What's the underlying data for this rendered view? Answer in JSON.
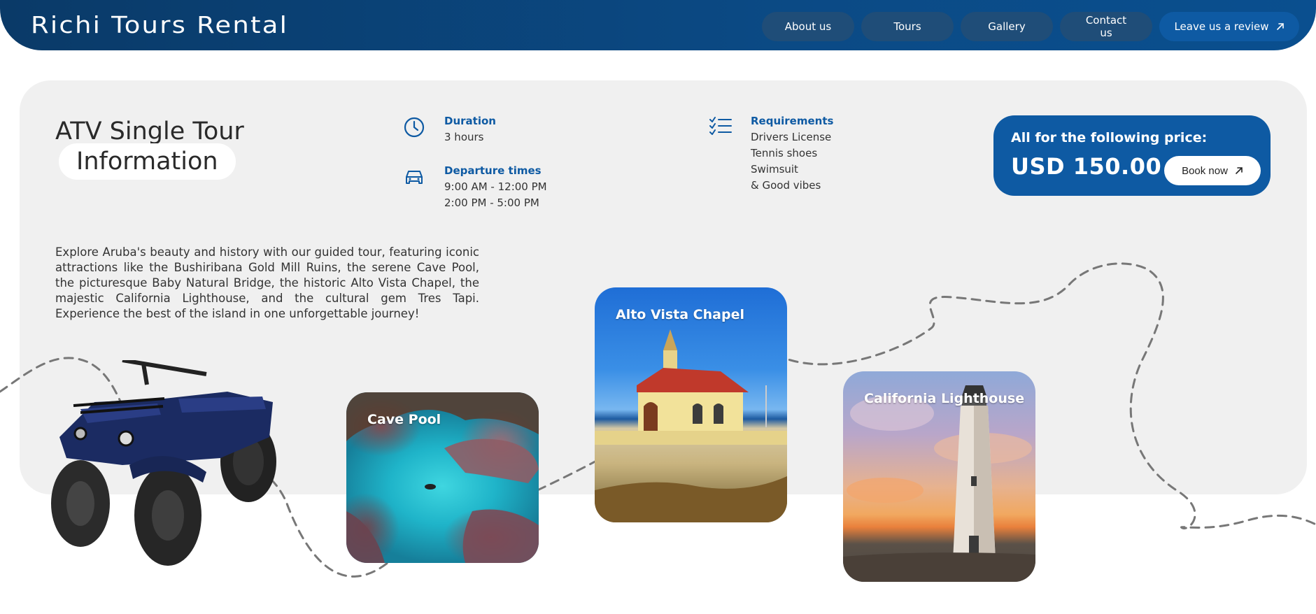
{
  "header": {
    "brand": "Richi Tours Rental",
    "nav": {
      "about": "About us",
      "tours": "Tours",
      "gallery": "Gallery",
      "contact": "Contact us",
      "review": "Leave us a review"
    },
    "background_color": "#0b4a85",
    "accent_color": "#0e5aa3"
  },
  "tour": {
    "title_line1": "ATV Single Tour",
    "title_line2": "Information",
    "duration": {
      "label": "Duration",
      "value": "3 hours",
      "icon": "clock-icon"
    },
    "departure": {
      "label": "Departure times",
      "times": [
        "9:00 AM - 12:00 PM",
        "2:00 PM - 5:00 PM"
      ],
      "icon": "car-icon"
    },
    "requirements": {
      "label": "Requirements",
      "items": [
        "Drivers License",
        "Tennis shoes",
        "Swimsuit",
        "& Good vibes"
      ],
      "icon": "checklist-icon"
    },
    "price": {
      "label": "All for the following price:",
      "value": "USD 150.00",
      "book": "Book now"
    },
    "description": "Explore Aruba's beauty and history with our guided tour, featuring iconic attractions like the Bushiribana Gold Mill Ruins, the serene Cave Pool, the picturesque Baby Natural Bridge, the historic Alto Vista Chapel, the majestic California Lighthouse, and the cultural gem Tres Tapi. Experience the best of the island in one unforgettable journey!"
  },
  "gallery": {
    "cards": [
      {
        "label": "Cave Pool"
      },
      {
        "label": "Alto Vista Chapel"
      },
      {
        "label": "California Lighthouse"
      }
    ]
  }
}
